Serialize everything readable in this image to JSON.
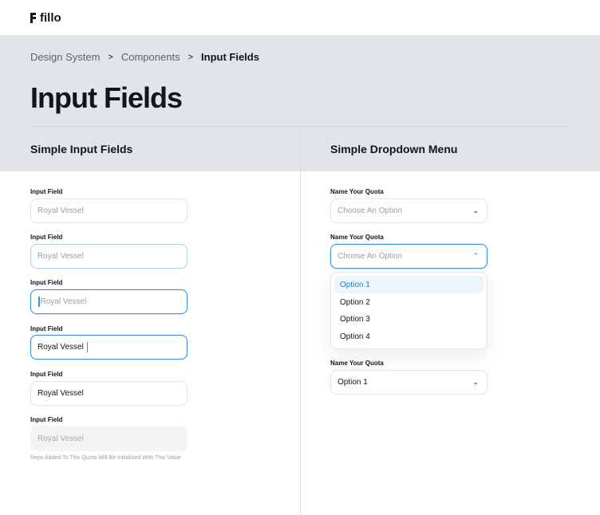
{
  "brand": {
    "name": "fillo"
  },
  "breadcrumb": [
    "Design System",
    "Components",
    "Input Fields"
  ],
  "page_title": "Input Fields",
  "left": {
    "title": "Simple Input Fields",
    "fields": [
      {
        "label": "Input Field",
        "value": "Royal Vessel",
        "state": "default"
      },
      {
        "label": "Input Field",
        "value": "Royal Vessel",
        "state": "hover"
      },
      {
        "label": "Input Field",
        "value": "Royal Vessel",
        "state": "focus"
      },
      {
        "label": "Input Field",
        "value": "Royal Vessel",
        "state": "typing"
      },
      {
        "label": "Input Field",
        "value": "Royal Vessel",
        "state": "filled"
      },
      {
        "label": "Input Field",
        "value": "Royal Vessel",
        "state": "disabled"
      }
    ],
    "helper": "Reps Added To This Quota Will Be Initialised With This Value"
  },
  "right": {
    "title": "Simple Dropdown Menu",
    "dropdowns": [
      {
        "label": "Name Your Quota",
        "value": "Choose An Option"
      },
      {
        "label": "Name Your Quota",
        "value": "Choose An Option"
      },
      {
        "label": "Name Your Quota",
        "value": "Option 1"
      }
    ],
    "options": [
      "Option 1",
      "Option 2",
      "Option 3",
      "Option 4"
    ]
  },
  "colors": {
    "accent": "#3a8fd9",
    "band": "#e1e5e8"
  }
}
